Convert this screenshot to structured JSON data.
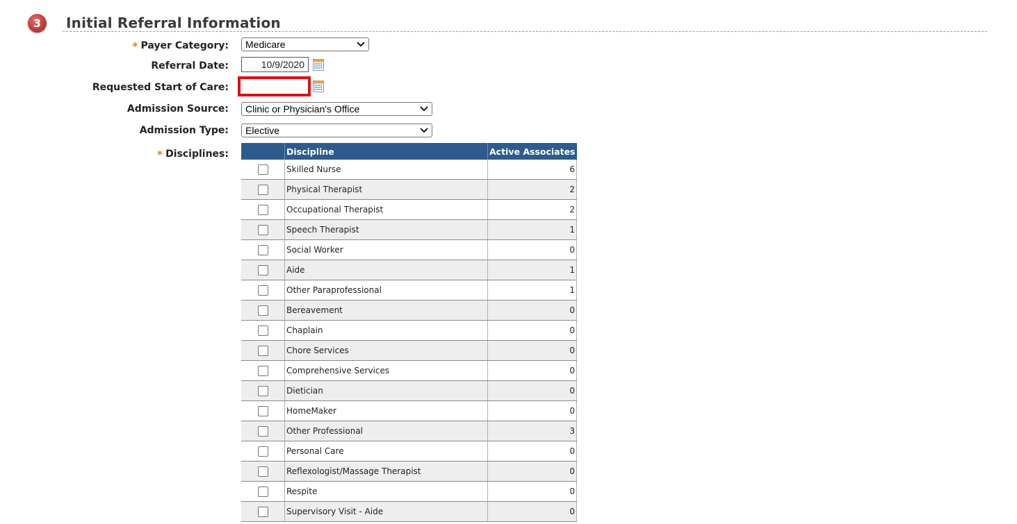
{
  "section": {
    "step_number": "3",
    "title": "Initial Referral Information"
  },
  "form": {
    "required_marker": "*",
    "payer_category": {
      "label": "Payer Category:",
      "value": "Medicare",
      "required": true
    },
    "referral_date": {
      "label": "Referral Date:",
      "value": "10/9/2020"
    },
    "requested_start_of_care": {
      "label": "Requested Start of Care:",
      "value": "",
      "error": true
    },
    "admission_source": {
      "label": "Admission Source:",
      "value": "Clinic or Physician's Office"
    },
    "admission_type": {
      "label": "Admission Type:",
      "value": "Elective"
    },
    "disciplines": {
      "label": "Disciplines:",
      "required": true
    }
  },
  "disciplines_table": {
    "headers": {
      "discipline": "Discipline",
      "active_associates": "Active Associates"
    },
    "rows": [
      {
        "discipline": "Skilled Nurse",
        "active_associates": "6",
        "checked": false
      },
      {
        "discipline": "Physical Therapist",
        "active_associates": "2",
        "checked": false
      },
      {
        "discipline": "Occupational Therapist",
        "active_associates": "2",
        "checked": false
      },
      {
        "discipline": "Speech Therapist",
        "active_associates": "1",
        "checked": false
      },
      {
        "discipline": "Social Worker",
        "active_associates": "0",
        "checked": false
      },
      {
        "discipline": "Aide",
        "active_associates": "1",
        "checked": false
      },
      {
        "discipline": "Other Paraprofessional",
        "active_associates": "1",
        "checked": false
      },
      {
        "discipline": "Bereavement",
        "active_associates": "0",
        "checked": false
      },
      {
        "discipline": "Chaplain",
        "active_associates": "0",
        "checked": false
      },
      {
        "discipline": "Chore Services",
        "active_associates": "0",
        "checked": false
      },
      {
        "discipline": "Comprehensive Services",
        "active_associates": "0",
        "checked": false
      },
      {
        "discipline": "Dietician",
        "active_associates": "0",
        "checked": false
      },
      {
        "discipline": "HomeMaker",
        "active_associates": "0",
        "checked": false
      },
      {
        "discipline": "Other Professional",
        "active_associates": "3",
        "checked": false
      },
      {
        "discipline": "Personal Care",
        "active_associates": "0",
        "checked": false
      },
      {
        "discipline": "Reflexologist/Massage Therapist",
        "active_associates": "0",
        "checked": false
      },
      {
        "discipline": "Respite",
        "active_associates": "0",
        "checked": false
      },
      {
        "discipline": "Supervisory Visit - Aide",
        "active_associates": "0",
        "checked": false
      }
    ]
  },
  "colors": {
    "header_bg": "#2e5b8e",
    "required_star": "#e8831a",
    "error_border": "#e01010",
    "step_badge": "#c23b3b",
    "row_alt": "#eeeeee"
  },
  "icons": {
    "step": "numbered-circle-icon",
    "calendar": "calendar-icon",
    "dropdown": "chevron-down-icon"
  }
}
